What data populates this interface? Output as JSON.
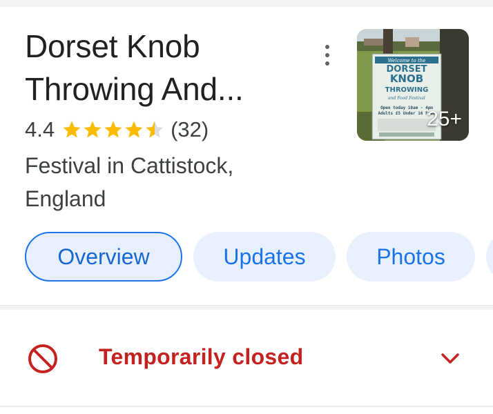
{
  "place": {
    "title_line1": "Dorset Knob",
    "title_line2": "Throwing And...",
    "rating": "4.4",
    "review_count": "(32)",
    "stars_filled": 4.4,
    "category_line1": "Festival in Cattistock,",
    "category_line2": "England"
  },
  "thumbnail": {
    "sign_lines": [
      "Welcome to the",
      "DORSET",
      "KNOB",
      "THROWING",
      "and Food Festival",
      "Open today 10am - 4pm",
      "Adults £5  Under 16 Free"
    ],
    "photo_count": "25+"
  },
  "tabs": [
    {
      "label": "Overview",
      "selected": true
    },
    {
      "label": "Updates",
      "selected": false
    },
    {
      "label": "Photos",
      "selected": false
    }
  ],
  "status": {
    "label": "Temporarily closed",
    "color": "#c5221f"
  },
  "colors": {
    "accent": "#1a73e8",
    "chip_bg": "#e8f0fe",
    "star": "#fbbc04",
    "alert": "#c5221f"
  },
  "icons": {
    "more": "more-vert-icon",
    "status": "block-icon",
    "expand": "chevron-down-icon",
    "star": "star-icon"
  }
}
